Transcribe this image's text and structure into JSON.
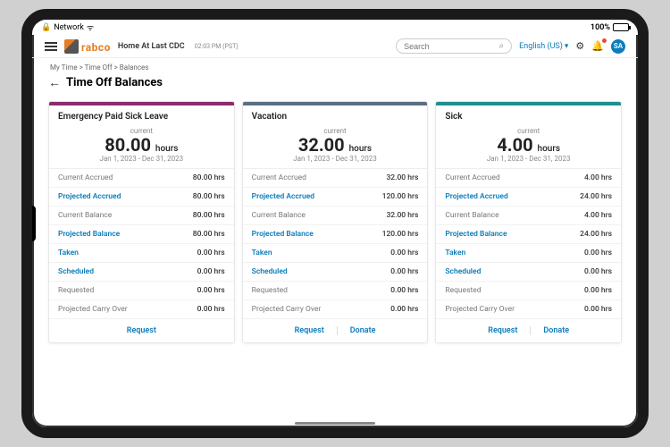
{
  "statusbar": {
    "network": "Network",
    "battery": "100%"
  },
  "header": {
    "brand": "rabco",
    "org": "Home At Last CDC",
    "org_time": "02:03 PM (PST)",
    "search_placeholder": "Search",
    "language": "English (US)",
    "avatar": "SA"
  },
  "breadcrumb": [
    "My Time",
    "Time Off",
    "Balances"
  ],
  "page_title": "Time Off Balances",
  "labels": {
    "current": "current",
    "hours_unit": "hours",
    "request": "Request",
    "donate": "Donate"
  },
  "row_labels": [
    "Current Accrued",
    "Projected Accrued",
    "Current Balance",
    "Projected Balance",
    "Taken",
    "Scheduled",
    "Requested",
    "Projected Carry Over"
  ],
  "row_link": [
    false,
    true,
    false,
    true,
    true,
    true,
    false,
    false
  ],
  "cards": [
    {
      "title": "Emergency Paid Sick Leave",
      "value": "80.00",
      "range": "Jan 1, 2023 - Dec 31, 2023",
      "vals": [
        "80.00 hrs",
        "80.00 hrs",
        "80.00 hrs",
        "80.00 hrs",
        "0.00 hrs",
        "0.00 hrs",
        "0.00 hrs",
        "0.00 hrs"
      ],
      "actions": [
        "request"
      ]
    },
    {
      "title": "Vacation",
      "value": "32.00",
      "range": "Jan 1, 2023 - Dec 31, 2023",
      "vals": [
        "32.00 hrs",
        "120.00 hrs",
        "32.00 hrs",
        "120.00 hrs",
        "0.00 hrs",
        "0.00 hrs",
        "0.00 hrs",
        "0.00 hrs"
      ],
      "actions": [
        "request",
        "donate"
      ]
    },
    {
      "title": "Sick",
      "value": "4.00",
      "range": "Jan 1, 2023 - Dec 31, 2023",
      "vals": [
        "4.00 hrs",
        "24.00 hrs",
        "4.00 hrs",
        "24.00 hrs",
        "0.00 hrs",
        "0.00 hrs",
        "0.00 hrs",
        "0.00 hrs"
      ],
      "actions": [
        "request",
        "donate"
      ]
    }
  ]
}
